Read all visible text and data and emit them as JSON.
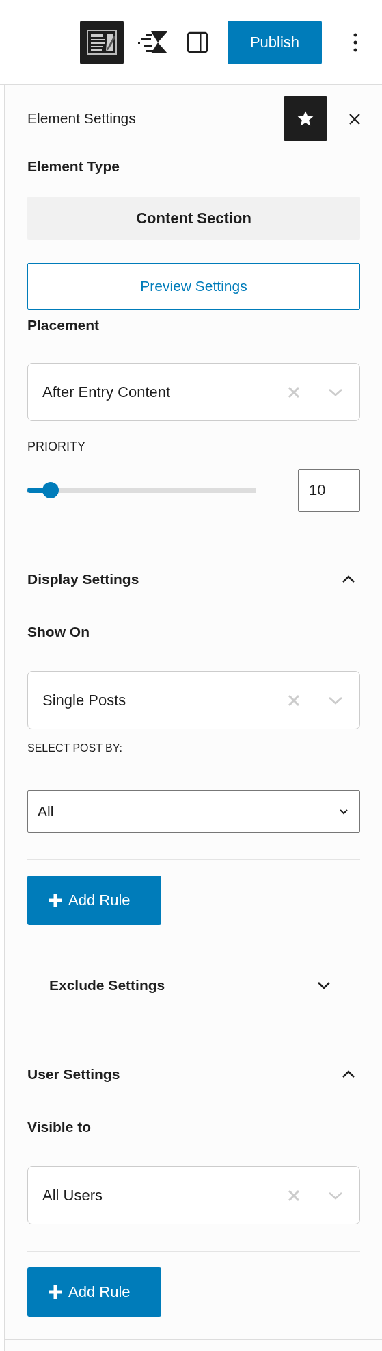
{
  "toolbar": {
    "editor_toggle": {
      "selected": true
    },
    "sidebar_toggle": {
      "selected": false
    },
    "publish": "Publish"
  },
  "panel": {
    "title": "Element Settings",
    "favorite": {
      "selected": true
    }
  },
  "fields": [
    {
      "kind": "label",
      "text": "Element Type"
    },
    {
      "kind": "static",
      "text": "Content Section"
    },
    {
      "kind": "outline-button",
      "text": "Preview Settings"
    },
    {
      "kind": "label",
      "text": "Placement"
    },
    {
      "kind": "select",
      "value": "After Entry Content"
    },
    {
      "kind": "caps",
      "text": "PRIORITY"
    },
    {
      "kind": "slider",
      "level": 0.1,
      "value": "10"
    }
  ],
  "sections": [
    {
      "title": "Display Settings",
      "expanded": true,
      "fields": [
        {
          "kind": "label",
          "text": "Show On"
        },
        {
          "kind": "select",
          "value": "Single Posts"
        },
        {
          "kind": "caps",
          "text": "SELECT POST BY:"
        },
        {
          "kind": "dropdown",
          "value": "All"
        },
        {
          "kind": "rule"
        },
        {
          "kind": "add-button",
          "text": "Add Rule"
        },
        {
          "kind": "rule"
        },
        {
          "kind": "subpanel",
          "title": "Exclude Settings",
          "expanded": false
        }
      ]
    },
    {
      "title": "User Settings",
      "expanded": true,
      "fields": [
        {
          "kind": "label",
          "text": "Visible to"
        },
        {
          "kind": "select",
          "value": "All Users"
        },
        {
          "kind": "rule"
        },
        {
          "kind": "add-button",
          "text": "Add Rule"
        }
      ]
    }
  ]
}
